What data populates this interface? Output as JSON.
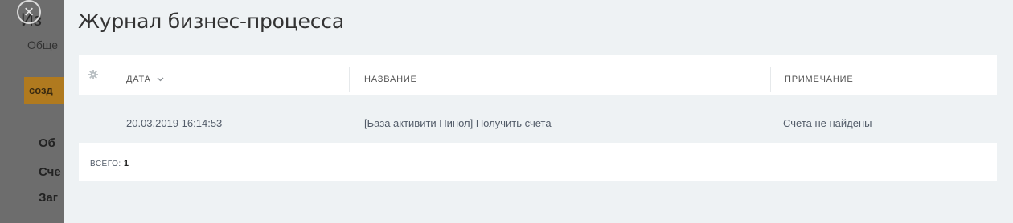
{
  "background_page": {
    "title_fragment": "Из",
    "subtitle_fragment": "Обще",
    "button_fragment": "созд",
    "nav_items": [
      "Об",
      "Сче",
      "Заг"
    ]
  },
  "close_label": "×",
  "panel": {
    "title": "Журнал бизнес-процесса"
  },
  "table": {
    "settings_icon": "gear-icon",
    "columns": [
      "ДАТА",
      "НАЗВАНИЕ",
      "ПРИМЕЧАНИЕ"
    ],
    "sort_indicator": "chevron-down-icon",
    "rows": [
      {
        "date": "20.03.2019 16:14:53",
        "name": "[База активити Пинол] Получить счета",
        "note": "Счета не найдены"
      }
    ],
    "footer": {
      "label": "ВСЕГО:",
      "count": "1"
    }
  },
  "colors": {
    "overlay": "#5b5b5b",
    "panel_bg": "#eef2f4",
    "card_bg": "#ffffff",
    "accent_button": "#b07a1f"
  }
}
